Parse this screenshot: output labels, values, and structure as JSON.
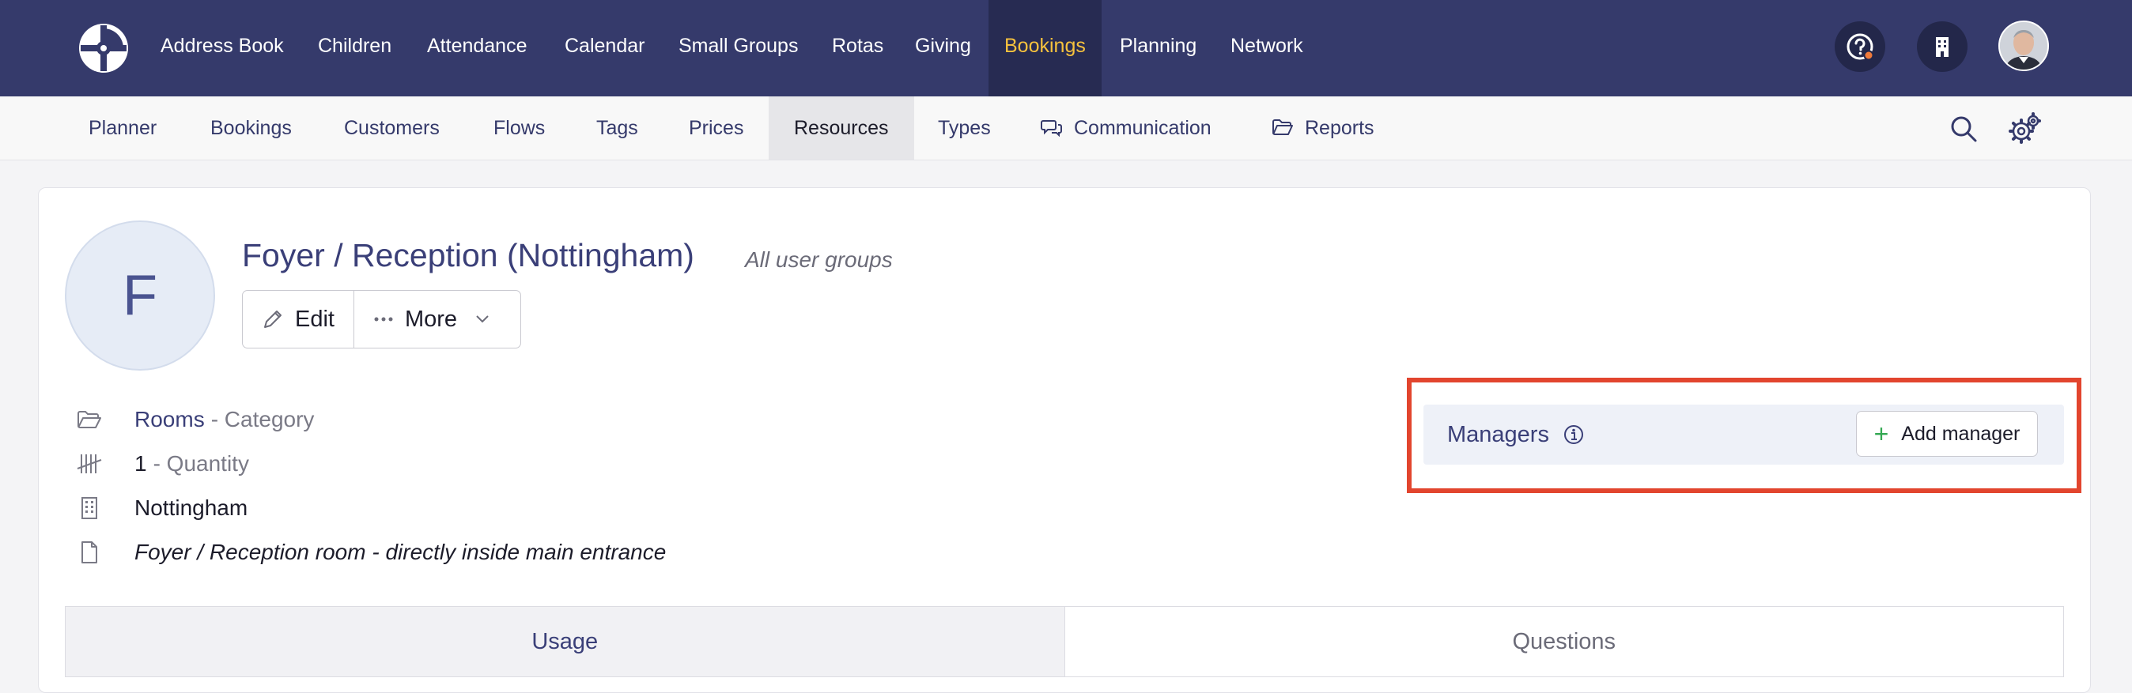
{
  "topnav": {
    "items": [
      "Address Book",
      "Children",
      "Attendance",
      "Calendar",
      "Small Groups",
      "Rotas",
      "Giving",
      "Bookings",
      "Planning",
      "Network"
    ],
    "active_item": "Bookings"
  },
  "subnav": {
    "items": [
      "Planner",
      "Bookings",
      "Customers",
      "Flows",
      "Tags",
      "Prices",
      "Resources",
      "Types",
      "Communication",
      "Reports"
    ],
    "active_item": "Resources"
  },
  "resource": {
    "avatar_letter": "F",
    "title": "Foyer / Reception (Nottingham)",
    "user_groups": "All user groups",
    "edit_label": "Edit",
    "more_label": "More",
    "category_value": "Rooms",
    "category_label": "- Category",
    "quantity_value": "1",
    "quantity_label": "- Quantity",
    "site": "Nottingham",
    "description": "Foyer / Reception room - directly inside main entrance"
  },
  "managers": {
    "label": "Managers",
    "add_label": "Add manager"
  },
  "tabs": [
    "Usage",
    "Questions"
  ],
  "colors": {
    "topnav_bg": "#353a6b",
    "active_accent": "#f7c23d",
    "highlight": "#e2452e",
    "plus_green": "#33a852"
  }
}
